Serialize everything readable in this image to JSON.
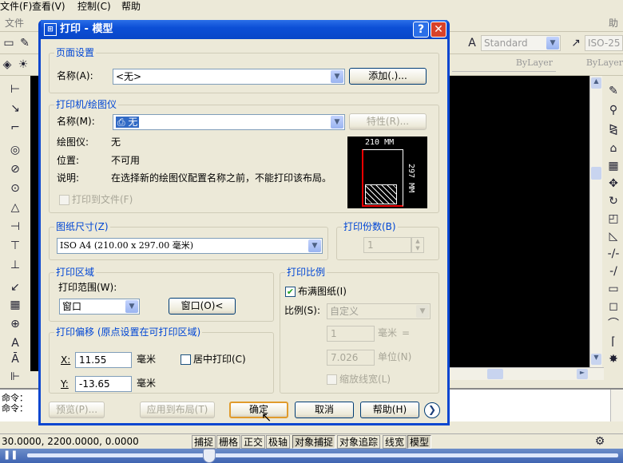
{
  "menubar": {
    "file": "文件(F)",
    "view": "查看(V)",
    "control": "控制(C)",
    "help": "帮助"
  },
  "bg_menu": {
    "file": "文件",
    "help": "助"
  },
  "toolbar": {
    "style": "Standard",
    "dimstyle": "ISO-25",
    "layer1": "ByLayer",
    "layer2": "ByLayer"
  },
  "dialog": {
    "title": "打印 - 模型",
    "page_setup": {
      "group": "页面设置",
      "name_label": "名称(A):",
      "name_value": "<无>",
      "add_button": "添加(.)..."
    },
    "printer": {
      "group": "打印机/绘图仪",
      "name_label": "名称(M):",
      "name_value": "无",
      "properties_button": "特性(R)...",
      "plotter_label": "绘图仪:",
      "plotter_value": "无",
      "location_label": "位置:",
      "location_value": "不可用",
      "desc_label": "说明:",
      "desc_value": "在选择新的绘图仪配置名称之前，不能打印该布局。",
      "print_to_file": "打印到文件(F)",
      "preview_width": "210 MM",
      "preview_height": "297 MM"
    },
    "paper": {
      "group": "图纸尺寸(Z)",
      "value": "ISO A4 (210.00 x 297.00 毫米)"
    },
    "copies": {
      "group": "打印份数(B)",
      "value": "1"
    },
    "area": {
      "group": "打印区域",
      "range_label": "打印范围(W):",
      "range_value": "窗口",
      "window_button": "窗口(O)<"
    },
    "offset": {
      "group": "打印偏移 (原点设置在可打印区域)",
      "x_label": "X:",
      "x_value": "11.55",
      "x_unit": "毫米",
      "y_label": "Y:",
      "y_value": "-13.65",
      "y_unit": "毫米",
      "center": "居中打印(C)"
    },
    "scale": {
      "group": "打印比例",
      "fit": "布满图纸(I)",
      "scale_label": "比例(S):",
      "scale_value": "自定义",
      "v1": "1",
      "unit1": "毫米",
      "eq": "=",
      "v2": "7.026",
      "unit2": "单位(N)",
      "lineweights": "缩放线宽(L)"
    },
    "buttons": {
      "preview": "预览(P)...",
      "apply": "应用到布局(T)",
      "ok": "确定",
      "cancel": "取消",
      "help": "帮助(H)"
    }
  },
  "command": {
    "line1": "命令：",
    "line2": "命令："
  },
  "status": {
    "coords": "30.0000, 2200.0000, 0.0000",
    "snap": "捕捉",
    "grid": "栅格",
    "ortho": "正交",
    "polar": "极轴",
    "osnap": "对象捕捉",
    "otrack": "对象追踪",
    "lwt": "线宽",
    "model": "模型"
  }
}
